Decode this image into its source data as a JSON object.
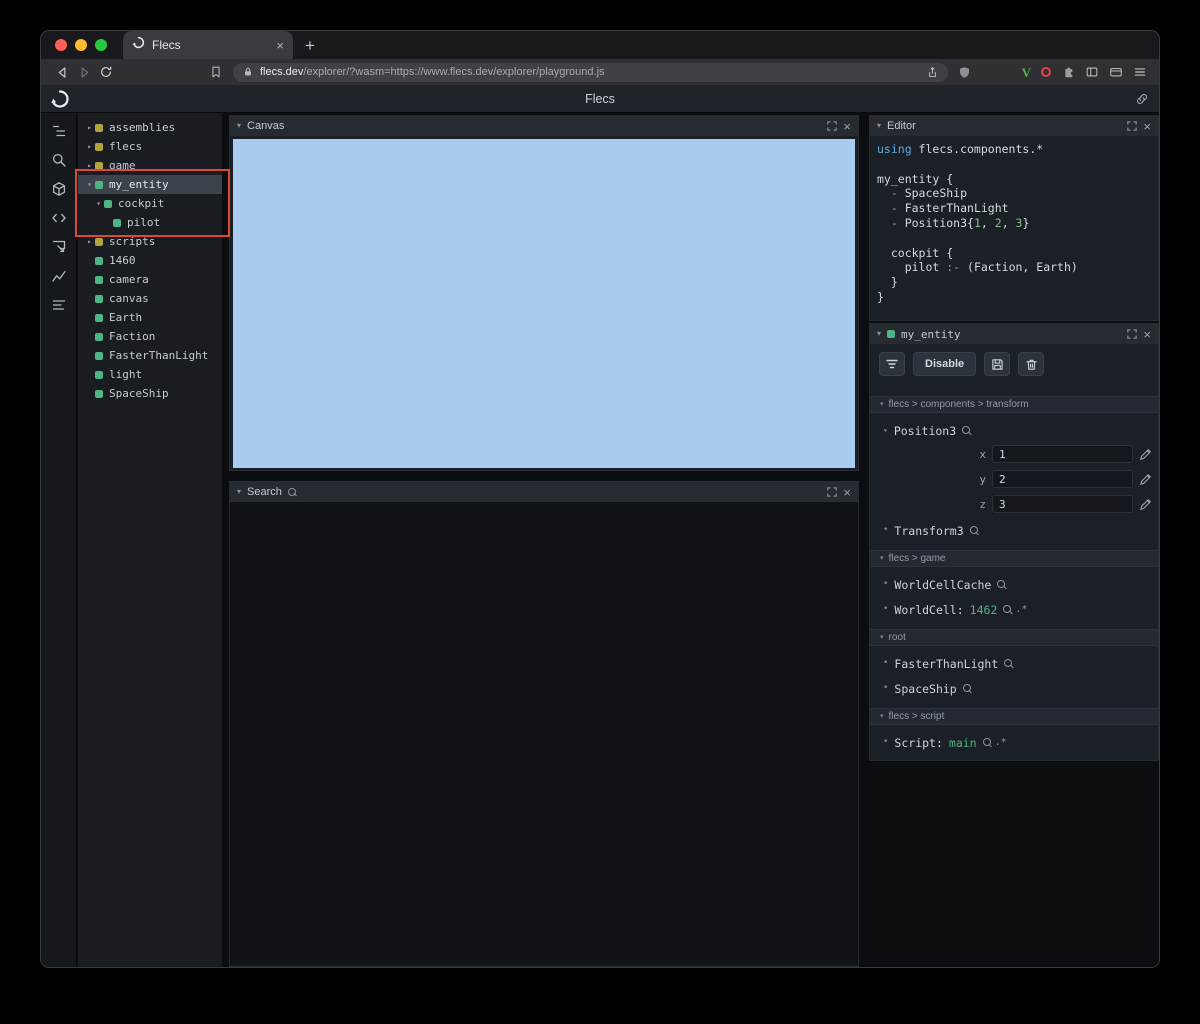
{
  "colors": {
    "green": "#4fb483",
    "yellow": "#b2a33f",
    "canvas_blue": "#a9cbee",
    "annotation": "#dd4a32"
  },
  "browser": {
    "tab_title": "Flecs",
    "url_domain": "flecs.dev",
    "url_path": "/explorer/?wasm=https://www.flecs.dev/explorer/playground.js"
  },
  "app_header": {
    "title": "Flecs"
  },
  "sidebar_icons": [
    "entities",
    "search",
    "cube",
    "code",
    "inspect",
    "chart",
    "stats"
  ],
  "tree": {
    "items": [
      {
        "label": "assemblies",
        "color": "yellow",
        "arrow": "right",
        "depth": 0,
        "selected": false
      },
      {
        "label": "flecs",
        "color": "yellow",
        "arrow": "right",
        "depth": 0,
        "selected": false
      },
      {
        "label": "game",
        "color": "yellow",
        "arrow": "right",
        "depth": 0,
        "selected": false
      },
      {
        "label": "my_entity",
        "color": "green",
        "arrow": "down",
        "depth": 0,
        "selected": true
      },
      {
        "label": "cockpit",
        "color": "green",
        "arrow": "down",
        "depth": 1,
        "selected": false
      },
      {
        "label": "pilot",
        "color": "green",
        "arrow": "none",
        "depth": 2,
        "selected": false
      },
      {
        "label": "scripts",
        "color": "yellow",
        "arrow": "right",
        "depth": 0,
        "selected": false
      },
      {
        "label": "1460",
        "color": "green",
        "arrow": "none",
        "depth": 0,
        "selected": false
      },
      {
        "label": "camera",
        "color": "green",
        "arrow": "none",
        "depth": 0,
        "selected": false
      },
      {
        "label": "canvas",
        "color": "green",
        "arrow": "none",
        "depth": 0,
        "selected": false
      },
      {
        "label": "Earth",
        "color": "green",
        "arrow": "none",
        "depth": 0,
        "selected": false
      },
      {
        "label": "Faction",
        "color": "green",
        "arrow": "none",
        "depth": 0,
        "selected": false
      },
      {
        "label": "FasterThanLight",
        "color": "green",
        "arrow": "none",
        "depth": 0,
        "selected": false
      },
      {
        "label": "light",
        "color": "green",
        "arrow": "none",
        "depth": 0,
        "selected": false
      },
      {
        "label": "SpaceShip",
        "color": "green",
        "arrow": "none",
        "depth": 0,
        "selected": false
      }
    ]
  },
  "canvas_panel": {
    "title": "Canvas"
  },
  "search_panel": {
    "title": "Search"
  },
  "editor_panel": {
    "title": "Editor",
    "code": [
      [
        {
          "t": "using",
          "c": "kw"
        },
        {
          "t": " flecs.components.*",
          "c": "pl"
        }
      ],
      [],
      [
        {
          "t": "my_entity {",
          "c": "pl"
        }
      ],
      [
        {
          "t": "  - ",
          "c": "pu"
        },
        {
          "t": "SpaceShip",
          "c": "pl"
        }
      ],
      [
        {
          "t": "  - ",
          "c": "pu"
        },
        {
          "t": "FasterThanLight",
          "c": "pl"
        }
      ],
      [
        {
          "t": "  - ",
          "c": "pu"
        },
        {
          "t": "Position3{",
          "c": "pl"
        },
        {
          "t": "1",
          "c": "num"
        },
        {
          "t": ", ",
          "c": "pl"
        },
        {
          "t": "2",
          "c": "num"
        },
        {
          "t": ", ",
          "c": "pl"
        },
        {
          "t": "3",
          "c": "num"
        },
        {
          "t": "}",
          "c": "pl"
        }
      ],
      [],
      [
        {
          "t": "  cockpit {",
          "c": "pl"
        }
      ],
      [
        {
          "t": "    pilot ",
          "c": "pl"
        },
        {
          "t": ":- ",
          "c": "pu"
        },
        {
          "t": "(Faction, Earth)",
          "c": "pl"
        }
      ],
      [
        {
          "t": "  }",
          "c": "pl"
        }
      ],
      [
        {
          "t": "}",
          "c": "pl"
        }
      ]
    ]
  },
  "inspector": {
    "title": "my_entity",
    "toolbar": {
      "disable_label": "Disable"
    },
    "sections": [
      {
        "path": "flecs > components > transform",
        "components": [
          {
            "name": "Position3",
            "expanded": true,
            "fields": [
              {
                "label": "x",
                "value": "1"
              },
              {
                "label": "y",
                "value": "2"
              },
              {
                "label": "z",
                "value": "3"
              }
            ]
          },
          {
            "name": "Transform3"
          }
        ]
      },
      {
        "path": "flecs > game",
        "components": [
          {
            "name": "WorldCellCache"
          },
          {
            "name": "WorldCell:",
            "value": "1462",
            "suffix": ".*"
          }
        ]
      },
      {
        "path": "root",
        "components": [
          {
            "name": "FasterThanLight"
          },
          {
            "name": "SpaceShip"
          }
        ]
      },
      {
        "path": "flecs > script",
        "components": [
          {
            "name": "Script:",
            "value": "main",
            "suffix": ".*"
          }
        ]
      }
    ]
  }
}
